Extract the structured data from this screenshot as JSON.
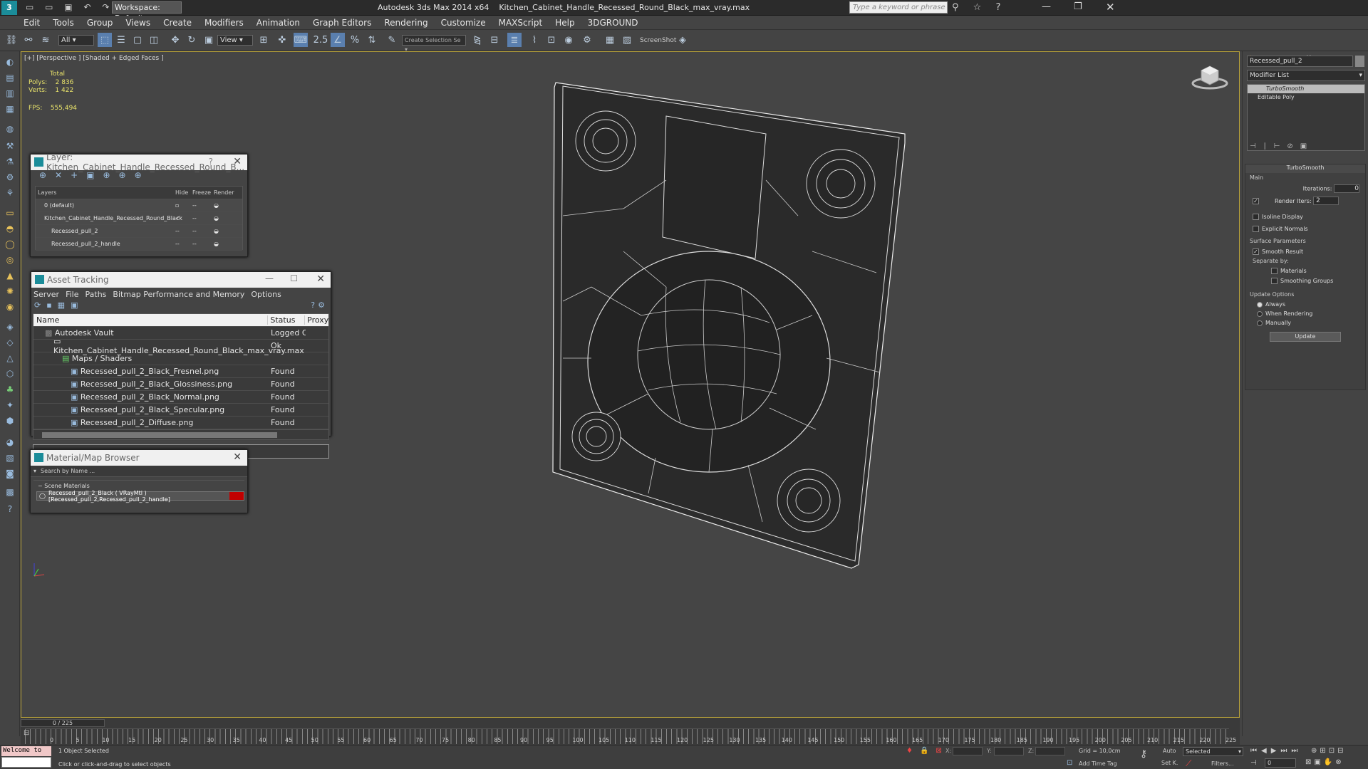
{
  "app": {
    "title": "Autodesk 3ds Max  2014 x64",
    "file": "Kitchen_Cabinet_Handle_Recessed_Round_Black_max_vray.max",
    "workspace": "Workspace: Default",
    "search_placeholder": "Type a keyword or phrase"
  },
  "menu": [
    "Edit",
    "Tools",
    "Group",
    "Views",
    "Create",
    "Modifiers",
    "Animation",
    "Graph Editors",
    "Rendering",
    "Customize",
    "MAXScript",
    "Help",
    "3DGROUND"
  ],
  "toolbar": {
    "filter": "All",
    "ref_coord": "View",
    "selection_set": "Create Selection Se",
    "screenshot": "ScreenShot"
  },
  "viewport": {
    "label": "[+] [Perspective ] [Shaded + Edged Faces ]",
    "stats": {
      "total": "Total",
      "polys_label": "Polys:",
      "polys": "2 836",
      "verts_label": "Verts:",
      "verts": "1 422",
      "fps_label": "FPS:",
      "fps": "555,494"
    }
  },
  "layer_panel": {
    "title": "Layer: Kitchen_Cabinet_Handle_Recessed_Round_B...",
    "help": "?",
    "cols": {
      "layers": "Layers",
      "hide": "Hide",
      "freeze": "Freeze",
      "render": "Render"
    },
    "rows": [
      "0 (default)",
      "Kitchen_Cabinet_Handle_Recessed_Round_Black",
      "Recessed_pull_2",
      "Recessed_pull_2_handle"
    ]
  },
  "asset_panel": {
    "title": "Asset Tracking",
    "menu": [
      "Server",
      "File",
      "Paths",
      "Bitmap Performance and Memory",
      "Options"
    ],
    "cols": {
      "name": "Name",
      "status": "Status",
      "proxy": "Proxy R"
    },
    "rows": [
      {
        "name": "Autodesk Vault",
        "status": "Logged O..."
      },
      {
        "name": "Kitchen_Cabinet_Handle_Recessed_Round_Black_max_vray.max",
        "status": "Ok"
      },
      {
        "name": "Maps / Shaders",
        "status": ""
      },
      {
        "name": "Recessed_pull_2_Black_Fresnel.png",
        "status": "Found"
      },
      {
        "name": "Recessed_pull_2_Black_Glossiness.png",
        "status": "Found"
      },
      {
        "name": "Recessed_pull_2_Black_Normal.png",
        "status": "Found"
      },
      {
        "name": "Recessed_pull_2_Black_Specular.png",
        "status": "Found"
      },
      {
        "name": "Recessed_pull_2_Diffuse.png",
        "status": "Found"
      }
    ]
  },
  "material_panel": {
    "title": "Material/Map Browser",
    "search": "Search by Name ...",
    "section": "Scene Materials",
    "item": "Recessed_pull_2_Black  ( VRayMtl )  [Recessed_pull_2,Recessed_pull_2_handle]"
  },
  "command_panel": {
    "object_name": "Recessed_pull_2",
    "modifier_list": "Modifier List",
    "stack": [
      "TurboSmooth",
      "Editable Poly"
    ],
    "rollout_title": "TurboSmooth",
    "main": "Main",
    "iterations_label": "Iterations:",
    "iterations": "0",
    "render_iters_label": "Render Iters:",
    "render_iters": "2",
    "isoline": "Isoline Display",
    "explicit": "Explicit Normals",
    "surface": "Surface Parameters",
    "smooth_result": "Smooth Result",
    "separate_by": "Separate by:",
    "materials": "Materials",
    "smoothing_groups": "Smoothing Groups",
    "update_options": "Update Options",
    "always": "Always",
    "when_rendering": "When Rendering",
    "manually": "Manually",
    "update": "Update"
  },
  "timeline": {
    "frame": "0 / 225",
    "ticks": [
      "0",
      "5",
      "10",
      "15",
      "20",
      "25",
      "30",
      "35",
      "40",
      "45",
      "50",
      "55",
      "60",
      "65",
      "70",
      "75",
      "80",
      "85",
      "90",
      "95",
      "100",
      "105",
      "110",
      "115",
      "120",
      "125",
      "130",
      "135",
      "140",
      "145",
      "150",
      "155",
      "160",
      "165",
      "170",
      "175",
      "180",
      "185",
      "190",
      "195",
      "200",
      "205",
      "210",
      "215",
      "220",
      "225"
    ]
  },
  "status": {
    "listener": "Welcome to",
    "selected": "1 Object Selected",
    "prompt": "Click or click-and-drag to select objects",
    "x_label": "X:",
    "y_label": "Y:",
    "z_label": "Z:",
    "grid": "Grid = 10,0cm",
    "add_time_tag": "Add Time Tag",
    "auto": "Auto",
    "set_k": "Set K.",
    "selected_mode": "Selected",
    "filters": "Filters...",
    "frame_field": "0"
  }
}
